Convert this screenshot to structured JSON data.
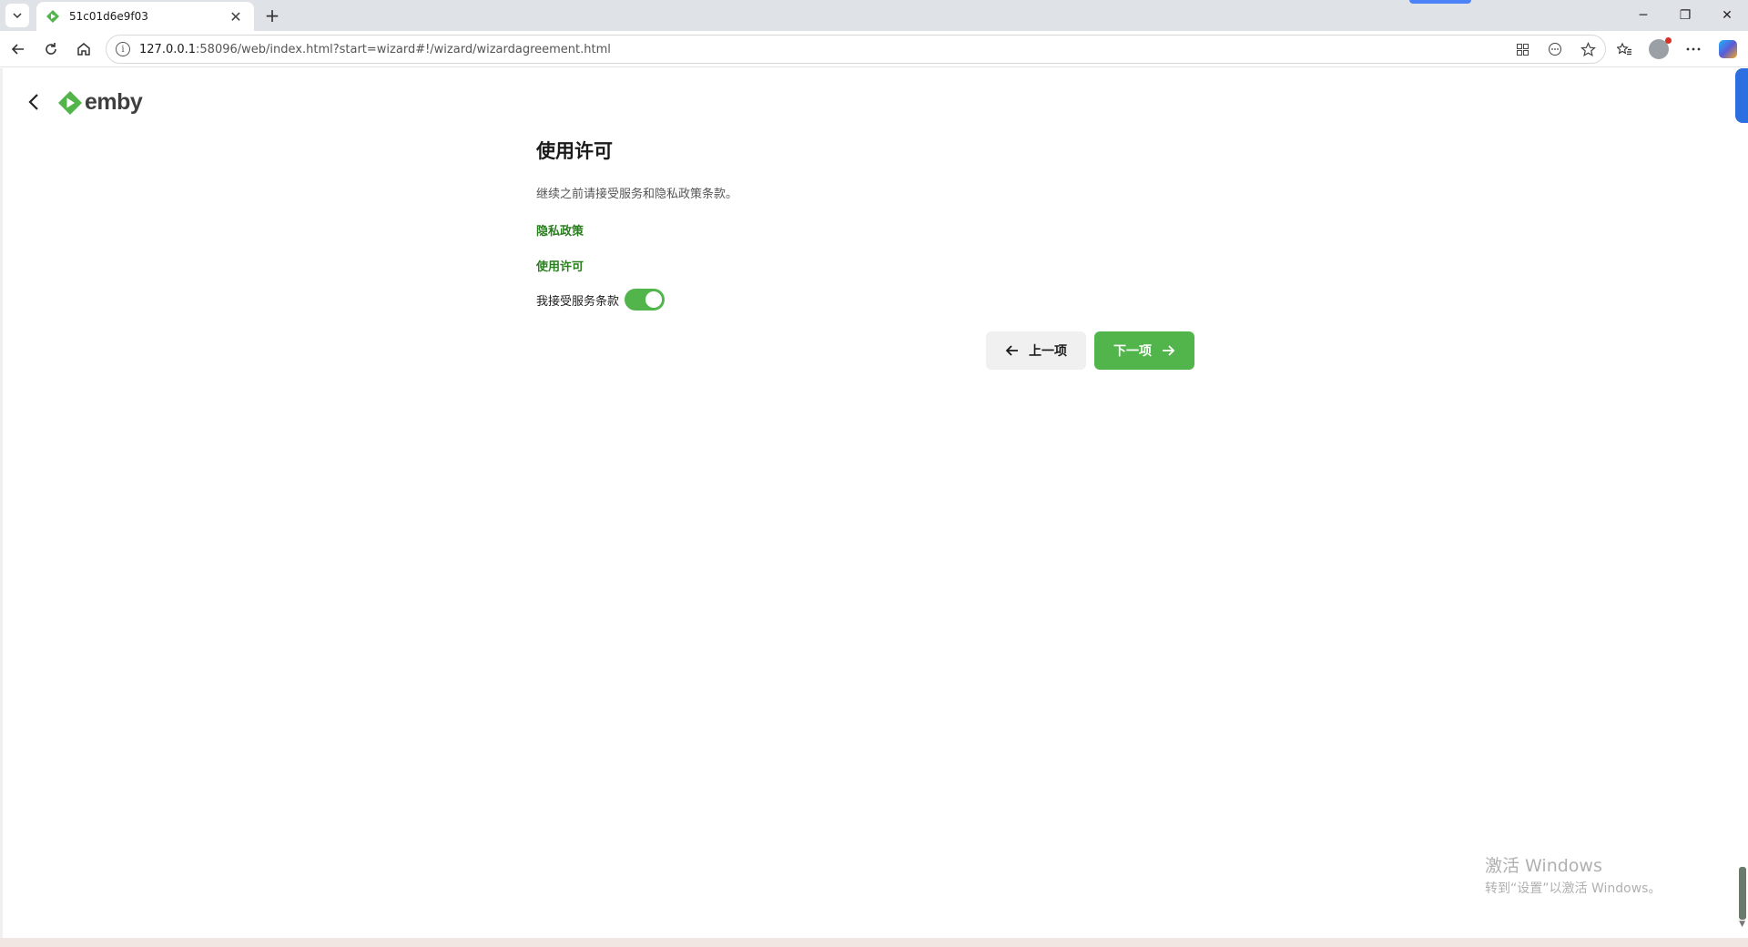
{
  "browser": {
    "tab_title": "51c01d6e9f03",
    "url_host": "127.0.0.1",
    "url_rest": ":58096/web/index.html?start=wizard#!/wizard/wizardagreement.html",
    "info_icon": "i",
    "new_tab": "+",
    "tab_close": "✕",
    "minimize": "─",
    "restore": "❐",
    "close": "✕"
  },
  "app": {
    "logo_text": "emby",
    "brand_color": "#52b54b"
  },
  "wizard": {
    "title": "使用许可",
    "description": "继续之前请接受服务和隐私政策条款。",
    "privacy_link": "隐私政策",
    "license_link": "使用许可",
    "accept_label": "我接受服务条款",
    "accept_checked": true,
    "prev_label": "上一项",
    "next_label": "下一项"
  },
  "watermark": {
    "title": "激活 Windows",
    "subtitle": "转到“设置”以激活 Windows。"
  }
}
